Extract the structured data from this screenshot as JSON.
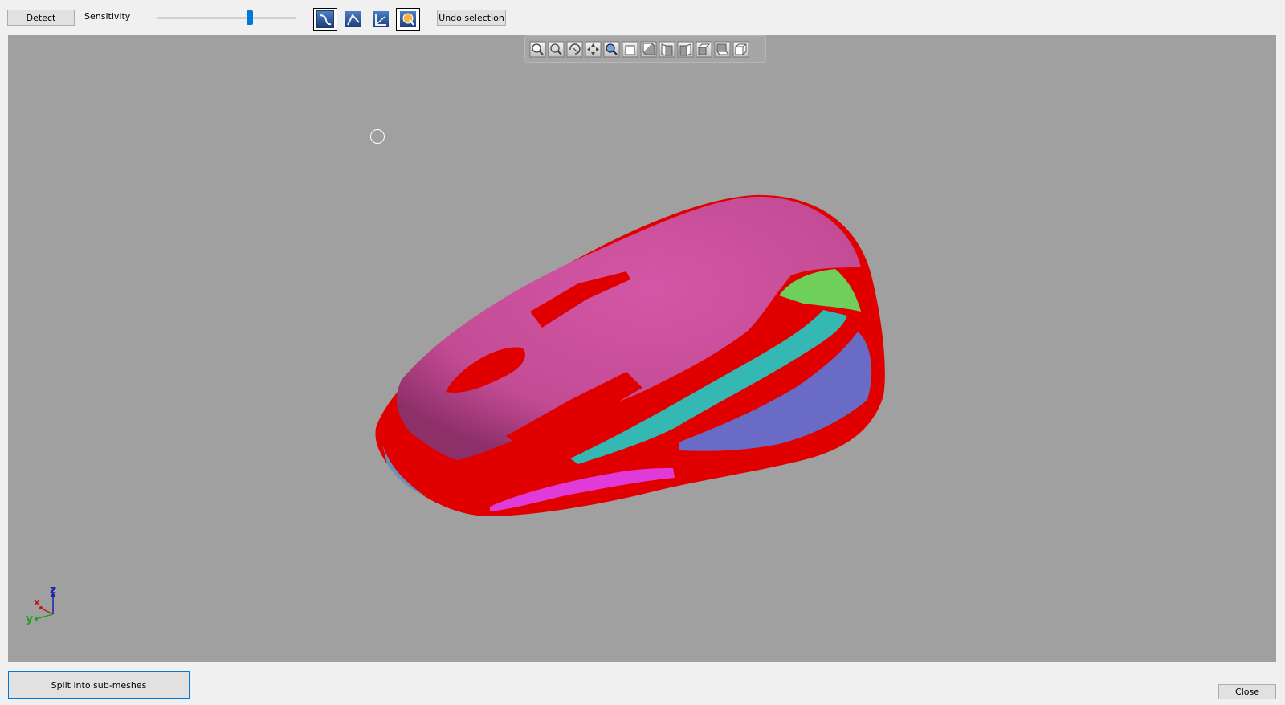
{
  "toolbar": {
    "detect_label": "Detect",
    "sensitivity_label": "Sensitivity",
    "sensitivity_value": 0.67,
    "undo_label": "Undo selection",
    "modes": [
      {
        "icon": "edge-select-icon",
        "active": true
      },
      {
        "icon": "curve-select-icon",
        "active": false
      },
      {
        "icon": "corner-select-icon",
        "active": false
      },
      {
        "icon": "paint-select-icon",
        "active": true
      }
    ]
  },
  "view_toolbar": {
    "icons": [
      "zoom-fit-icon",
      "zoom-icon",
      "rotate-icon",
      "pan-icon",
      "zoom-window-icon",
      "view-front-icon",
      "view-back-icon",
      "view-left-icon",
      "view-right-icon",
      "view-top-icon",
      "view-bottom-icon",
      "view-iso-icon"
    ]
  },
  "axis": {
    "x": "x",
    "y": "y",
    "z": "z"
  },
  "colors": {
    "background": "#a0a0a0",
    "shell": "#c94b96",
    "red_region": "#e00000",
    "cyan_region": "#35b8b4",
    "green_region": "#6fcf5b",
    "blue_region": "#6a6bc4",
    "magenta_region": "#e03ad8",
    "accent": "#0078d7"
  },
  "footer": {
    "split_label": "Split into sub-meshes",
    "close_label": "Close"
  }
}
